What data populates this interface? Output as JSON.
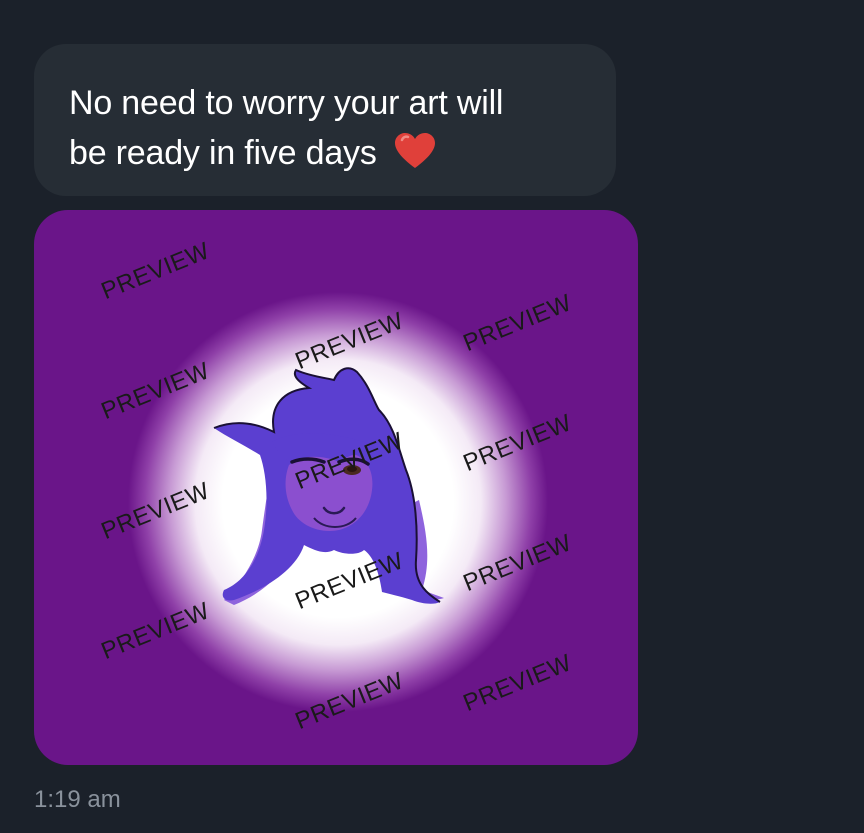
{
  "message": {
    "line1": "No need to worry your art will",
    "line2": "be ready in five days",
    "emoji": "heart-emoji"
  },
  "image": {
    "watermark": "PREVIEW",
    "bg_color": "#6a1589",
    "character_color": "#5b3fd0"
  },
  "timestamp": "1:19 am",
  "colors": {
    "background": "#1b212a",
    "bubble": "#262d35",
    "heart": "#e0403a"
  }
}
